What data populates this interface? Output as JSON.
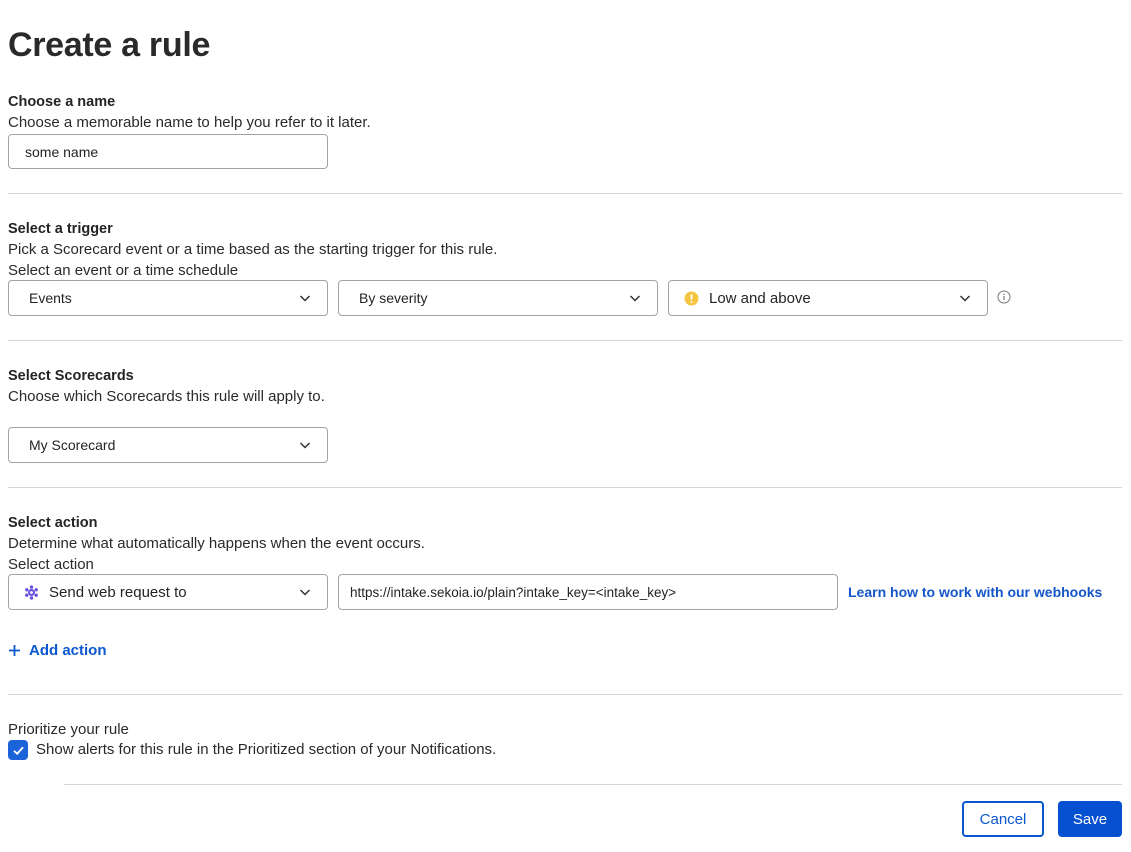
{
  "page": {
    "title": "Create a rule"
  },
  "name_section": {
    "title": "Choose a name",
    "description": "Choose a memorable name to help you refer to it later.",
    "name_value": "some name"
  },
  "trigger_section": {
    "title": "Select a trigger",
    "description": "Pick a Scorecard event or a time based as the starting trigger for this rule.",
    "field_label": "Select an event or a time schedule",
    "trigger_type": "Events",
    "trigger_filter": "By severity",
    "severity": "Low and above",
    "severity_icon": "warning-circle-icon",
    "severity_color": "#f5c542",
    "info_icon": "info-icon"
  },
  "scorecards_section": {
    "title": "Select Scorecards",
    "description": "Choose which Scorecards this rule will apply to.",
    "selected_scorecard": "My Scorecard"
  },
  "action_section": {
    "title": "Select action",
    "description": "Determine what automatically happens when the event occurs.",
    "field_label": "Select action",
    "action_type": "Send web request to",
    "action_icon": "webhook-icon",
    "action_icon_color": "#6b4fe0",
    "webhook_url": "https://intake.sekoia.io/plain?intake_key=<intake_key>",
    "webhook_help_link": "Learn how to work with our webhooks",
    "add_action_label": "Add action"
  },
  "priority_section": {
    "title": "Prioritize your rule",
    "checkbox_label": "Show alerts for this rule in the Prioritized section of your Notifications.",
    "checked": true
  },
  "footer": {
    "cancel_label": "Cancel",
    "save_label": "Save"
  },
  "colors": {
    "accent": "#0b57d0",
    "primary_button": "#0550d0",
    "checkbox": "#1b63d9",
    "divider": "#d6d6d6"
  }
}
